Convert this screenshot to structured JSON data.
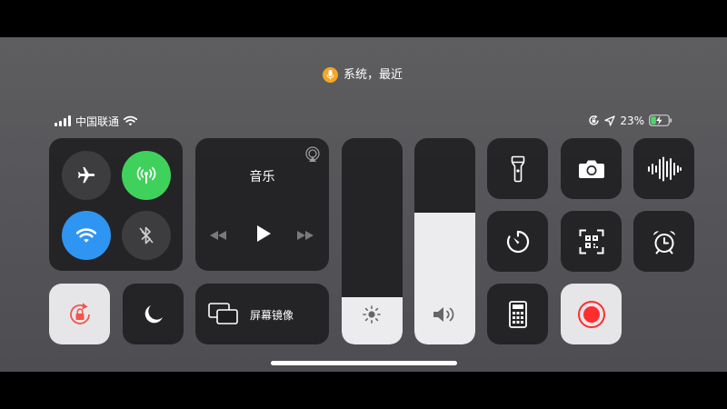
{
  "status_bar": {
    "mic_label": "系统，最近",
    "carrier": "中国联通",
    "battery_percent": "23%",
    "signal_bars": 4,
    "icons": [
      "signal-bars-icon",
      "wifi-icon",
      "orientation-lock-icon",
      "location-arrow-icon",
      "battery-charging-icon"
    ]
  },
  "connectivity": {
    "airplane_mode": false,
    "cellular_data": true,
    "wifi": true,
    "bluetooth": false
  },
  "music": {
    "title": "音乐",
    "icons": [
      "airplay-icon",
      "previous-track-icon",
      "play-icon",
      "next-track-icon"
    ]
  },
  "screen_mirroring": {
    "label": "屏幕镜像"
  },
  "brightness": {
    "level": 0.23
  },
  "volume": {
    "level": 0.64
  },
  "controls": [
    "flashlight-icon",
    "camera-icon",
    "voice-memo-icon",
    "timer-icon",
    "qr-scanner-icon",
    "alarm-icon",
    "calculator-icon",
    "screen-record-icon"
  ],
  "toggles": {
    "rotation_lock": true,
    "do_not_disturb": false
  },
  "colors": {
    "mic_indicator": "#f5a623",
    "cellular_active": "#3fd15c",
    "wifi_active": "#2f95f2",
    "rotation_lock": "#f2564b",
    "record": "#ff2d2d"
  }
}
